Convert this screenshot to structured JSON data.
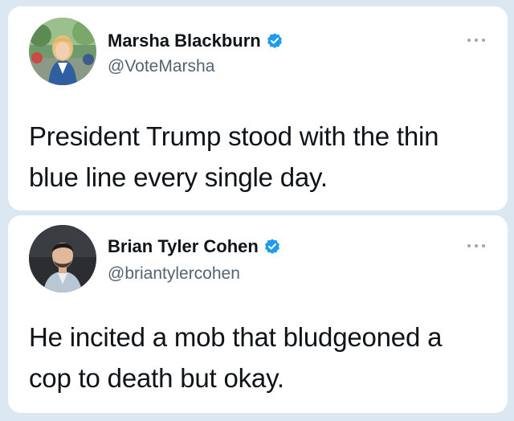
{
  "colors": {
    "background": "#dbe7f1",
    "card": "#ffffff",
    "text": "#0f1419",
    "muted": "#536471",
    "verified": "#1d9bf0"
  },
  "tweets": [
    {
      "display_name": "Marsha Blackburn",
      "handle": "@VoteMarsha",
      "verified": true,
      "avatar_icon": "profile-photo-woman-blonde-blue-jacket",
      "text": "President Trump stood with the thin blue line every single day."
    },
    {
      "display_name": "Brian Tyler Cohen",
      "handle": "@briantylercohen",
      "verified": true,
      "avatar_icon": "profile-photo-man-dark-hair-beard",
      "text": "He incited a mob that bludgeoned a cop to death but okay."
    }
  ]
}
